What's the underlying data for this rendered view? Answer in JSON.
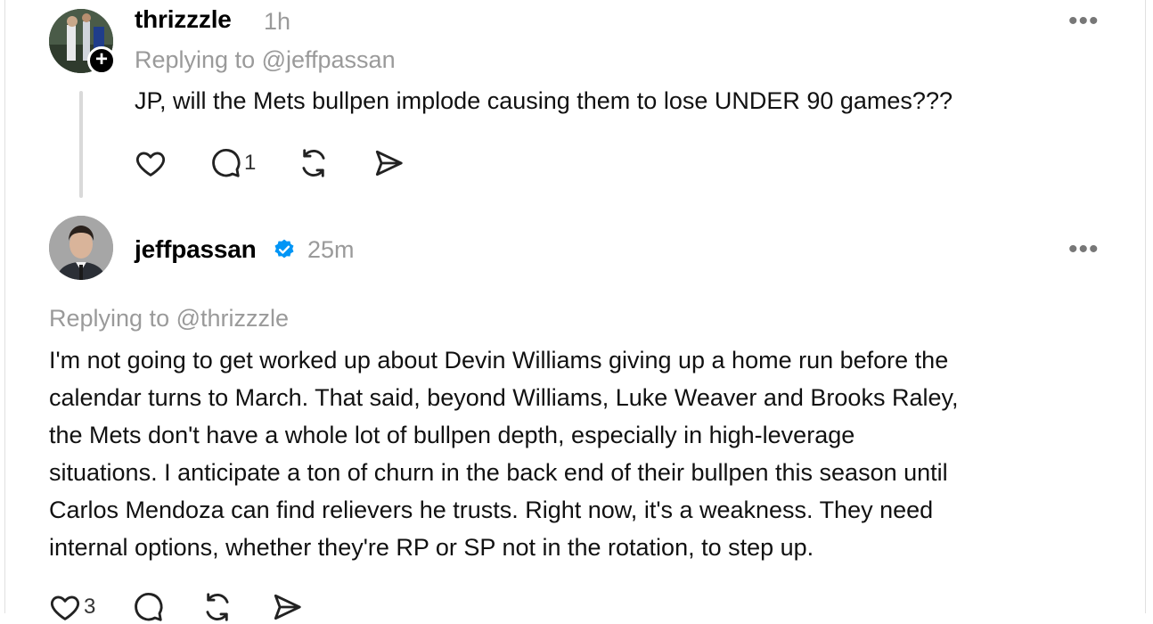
{
  "posts": [
    {
      "username": "thrizzzle",
      "time": "1h",
      "replying_to": "Replying to @jeffpassan",
      "text": "JP, will the Mets bullpen implode causing them to lose UNDER 90 games???",
      "like_count": "",
      "reply_count": "1",
      "follow_badge": "+",
      "more": "•••"
    },
    {
      "username": "jeffpassan",
      "verified": true,
      "time": "25m",
      "replying_to": "Replying to @thrizzzle",
      "lines": [
        "I'm not going to get worked up about Devin Williams giving up a home run before the",
        "calendar turns to March. That said, beyond Williams, Luke Weaver and Brooks Raley,",
        "the Mets don't have a whole lot of bullpen depth, especially in high-leverage",
        "situations. I anticipate a ton of churn in the back end of their bullpen this season until",
        "Carlos Mendoza can find relievers he trusts. Right now, it's a weakness. They need",
        "internal options, whether they're RP or SP not in the rotation, to step up."
      ],
      "like_count": "3",
      "more": "•••"
    }
  ],
  "colors": {
    "verified": "#0095f6",
    "muted": "#9a9a9a"
  }
}
